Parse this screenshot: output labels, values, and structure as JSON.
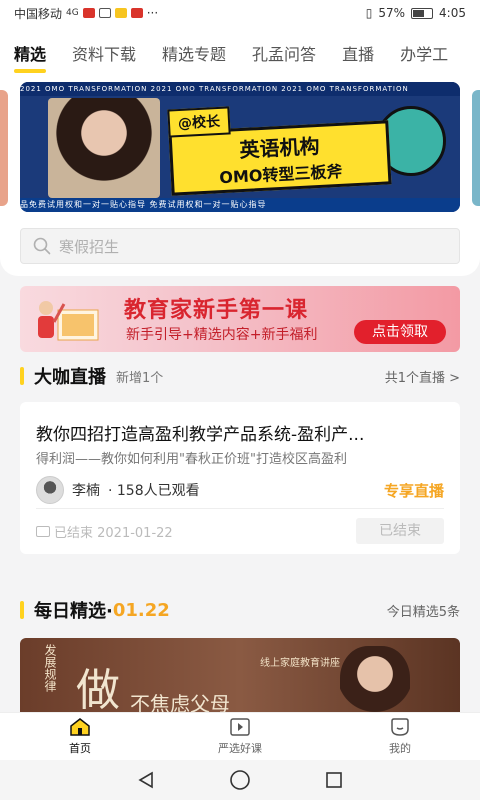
{
  "status_bar": {
    "carrier": "中国移动",
    "network": "4G",
    "battery": "57%",
    "time": "4:05",
    "dots": "···"
  },
  "tabs": [
    {
      "label": "精选",
      "active": true
    },
    {
      "label": "资料下载",
      "active": false
    },
    {
      "label": "精选专题",
      "active": false
    },
    {
      "label": "孔孟问答",
      "active": false
    },
    {
      "label": "直播",
      "active": false
    },
    {
      "label": "办学工",
      "active": false
    }
  ],
  "banner": {
    "strip_top": "2021 OMO TRANSFORMATION  2021 OMO TRANSFORMATION  2021 OMO TRANSFORMATION",
    "caption": "@校长",
    "title_line1": "英语机构",
    "title_line2": "OMO转型三板斧",
    "strip_bottom": "品免费试用权和一对一贴心指导  免费试用权和一对一贴心指导"
  },
  "search": {
    "placeholder": "寒假招生"
  },
  "promo": {
    "title": "教育家新手第一课",
    "subtitle": "新手引导+精选内容+新手福利",
    "button": "点击领取"
  },
  "live_section": {
    "title": "大咖直播",
    "subtitle": "新增1个",
    "more": "共1个直播 >",
    "card": {
      "title": "教你四招打造高盈利教学产品系统-盈利产...",
      "desc": "得利润——教你如何利用\"春秋正价班\"打造校区高盈利",
      "author": "李楠",
      "viewers": "· 158人已观看",
      "tag": "专享直播",
      "time": "已结束 2021-01-22",
      "status_button": "已结束"
    }
  },
  "daily_section": {
    "title": "每日精选·",
    "date": "01.22",
    "more": "今日精选5条",
    "banner": {
      "vertical_text": "发展规律",
      "big_char": "做",
      "small_text": "线上家庭教育讲座",
      "subline": "不焦虑父母"
    }
  },
  "bottom_nav": [
    {
      "label": "首页",
      "icon": "home-icon",
      "active": true
    },
    {
      "label": "严选好课",
      "icon": "play-icon",
      "active": false
    },
    {
      "label": "我的",
      "icon": "profile-icon",
      "active": false
    }
  ],
  "colors": {
    "accent": "#ffd21f",
    "orange": "#f5a623",
    "red": "#e2202c"
  }
}
